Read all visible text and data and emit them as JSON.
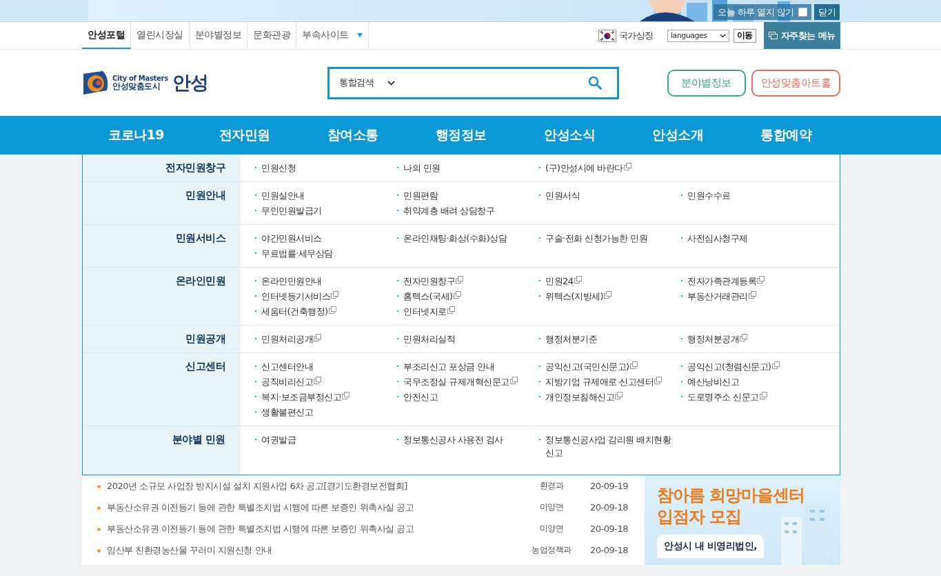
{
  "banner": {
    "kind": "picture",
    "dismiss_label": "오늘 하루 열지 않기",
    "dismiss_checked": false,
    "close": "닫기"
  },
  "utility": {
    "tabs": [
      {
        "label": "안성포털",
        "selected": true,
        "dropdown": false
      },
      {
        "label": "열린시장실",
        "selected": false,
        "dropdown": false
      },
      {
        "label": "분야별정보",
        "selected": false,
        "dropdown": false
      },
      {
        "label": "문화관광",
        "selected": false,
        "dropdown": false
      },
      {
        "label": "부속사이트",
        "selected": false,
        "dropdown": true
      }
    ],
    "symbol": "국가상징",
    "language": "languages",
    "go": "이동",
    "favorites": "자주찾는 메뉴"
  },
  "header": {
    "logo": {
      "tagline": "City of Masters",
      "slogan": "안성맞춤도시",
      "name": "안성"
    },
    "search": {
      "scope": "통합검색"
    },
    "buttons": [
      {
        "label": "분야별정보",
        "color": "#3aa68c"
      },
      {
        "label": "안성맞춤아트홀",
        "color": "#ec6b5e"
      }
    ]
  },
  "nav": [
    "코로나19",
    "전자민원",
    "참여소통",
    "행정정보",
    "안성소식",
    "안성소개",
    "통합예약"
  ],
  "menu": [
    {
      "title": "전자민원창구",
      "items": [
        {
          "label": "민원신청",
          "external": false
        },
        {
          "label": "나의 민원",
          "external": false
        },
        {
          "label": "(구)안성시에 바란다",
          "external": true
        }
      ]
    },
    {
      "title": "민원안내",
      "items": [
        {
          "label": "민원실안내",
          "external": false
        },
        {
          "label": "민원편람",
          "external": false
        },
        {
          "label": "민원서식",
          "external": false
        },
        {
          "label": "민원수수료",
          "external": false
        },
        {
          "label": "무인민원발급기",
          "external": false
        },
        {
          "label": "취약계층 배려 상담창구",
          "external": false
        }
      ]
    },
    {
      "title": "민원서비스",
      "items": [
        {
          "label": "야간민원서비스",
          "external": false
        },
        {
          "label": "온라인채팅·화상(수화)상담",
          "external": false
        },
        {
          "label": "구술·전화 신청가능한 민원",
          "external": false
        },
        {
          "label": "사전심사청구제",
          "external": false
        },
        {
          "label": "무료법률·세무상담",
          "external": false
        }
      ]
    },
    {
      "title": "온라인민원",
      "items": [
        {
          "label": "온라인민원안내",
          "external": false
        },
        {
          "label": "전자민원창구",
          "external": true
        },
        {
          "label": "민원24",
          "external": true
        },
        {
          "label": "전자가족관계등록",
          "external": true
        },
        {
          "label": "인터넷등기서비스",
          "external": true
        },
        {
          "label": "홈텍스(국세)",
          "external": true
        },
        {
          "label": "위텍스(지방세)",
          "external": true
        },
        {
          "label": "부동산거래관리",
          "external": true
        },
        {
          "label": "세움터(건축행정)",
          "external": true
        },
        {
          "label": "인터넷지로",
          "external": true
        }
      ]
    },
    {
      "title": "민원공개",
      "items": [
        {
          "label": "민원처리공개",
          "external": true
        },
        {
          "label": "민원처리실적",
          "external": false
        },
        {
          "label": "행정처분기준",
          "external": false
        },
        {
          "label": "행정처분공개",
          "external": true
        }
      ]
    },
    {
      "title": "신고센터",
      "items": [
        {
          "label": "신고센터안내",
          "external": false
        },
        {
          "label": "부조리신고 포상금 안내",
          "external": false
        },
        {
          "label": "공익신고(국민신문고)",
          "external": true
        },
        {
          "label": "공익신고(청렴신문고)",
          "external": true
        },
        {
          "label": "공직비리신고",
          "external": true
        },
        {
          "label": "국무조정실 규제개혁신문고",
          "external": true
        },
        {
          "label": "지방기업 규제애로 신고센터",
          "external": true
        },
        {
          "label": "예산낭비신고",
          "external": false
        },
        {
          "label": "복지·보조금부정신고",
          "external": true
        },
        {
          "label": "안전신고",
          "external": false
        },
        {
          "label": "개인정보침해신고",
          "external": true
        },
        {
          "label": "도로명주소 신문고",
          "external": true
        },
        {
          "label": "생활불편신고",
          "external": false
        }
      ]
    },
    {
      "title": "분야별 민원",
      "items": [
        {
          "label": "여권발급",
          "external": false
        },
        {
          "label": "정보통신공사 사용전 검사",
          "external": false
        },
        {
          "label": "정보통신공사업 감리원 배치현황 신고",
          "external": false
        }
      ]
    }
  ],
  "news": [
    {
      "title": "2020년 소규모 사업장 방지시설 설치 지원사업 6차 공고[경기도환경보전협회]",
      "dept": "환경과",
      "date": "20-09-19"
    },
    {
      "title": "부동산소유권 이전등기 등에 관한 특별조치법 시행에 따른 보증인 위촉사실 공고",
      "dept": "미양면",
      "date": "20-09-18"
    },
    {
      "title": "부동산소유권 이전등기 등에 관한 특별조치법 시행에 따른 보증인 위촉사실 공고",
      "dept": "미양면",
      "date": "20-09-18"
    },
    {
      "title": "임산부 친환경농산물 꾸러미 지원신청 안내",
      "dept": "농업정책과",
      "date": "20-09-18"
    }
  ],
  "promo": {
    "lines": [
      "참아름 희망마을센터",
      "입점자 모집"
    ],
    "caption": "안성시 내 비영리법인,"
  }
}
